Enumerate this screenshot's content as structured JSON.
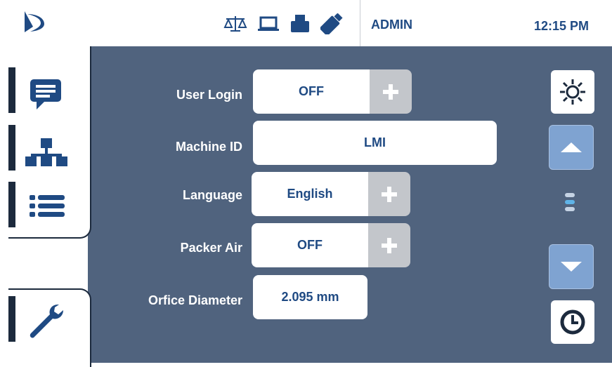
{
  "header": {
    "user": "ADMIN",
    "time": "12:15 PM",
    "status_icons": [
      "scale-icon",
      "laptop-icon",
      "printer-icon",
      "usb-drive-icon"
    ]
  },
  "sidebar": {
    "tabs": [
      {
        "icon": "message-icon",
        "active": false
      },
      {
        "icon": "network-icon",
        "active": false
      },
      {
        "icon": "list-icon",
        "active": false
      },
      {
        "icon": "gears-icon",
        "active": true
      },
      {
        "icon": "wrench-icon",
        "active": false
      }
    ]
  },
  "settings": {
    "user_login": {
      "label": "User Login",
      "value": "OFF"
    },
    "machine_id": {
      "label": "Machine ID",
      "value": "LMI"
    },
    "language": {
      "label": "Language",
      "value": "English"
    },
    "packer_air": {
      "label": "Packer Air",
      "value": "OFF"
    },
    "orifice_diameter": {
      "label": "Orfice Diameter",
      "value": "2.095 mm"
    }
  },
  "right_controls": {
    "page_current": 2,
    "page_total": 3
  },
  "colors": {
    "panel": "#50637e",
    "brand_blue": "#1f4a83",
    "accent_blue": "#7fa3d1",
    "dark": "#1c2a3d",
    "dot_active": "#5fb4e8",
    "dot_inactive": "#c5d3e4"
  }
}
